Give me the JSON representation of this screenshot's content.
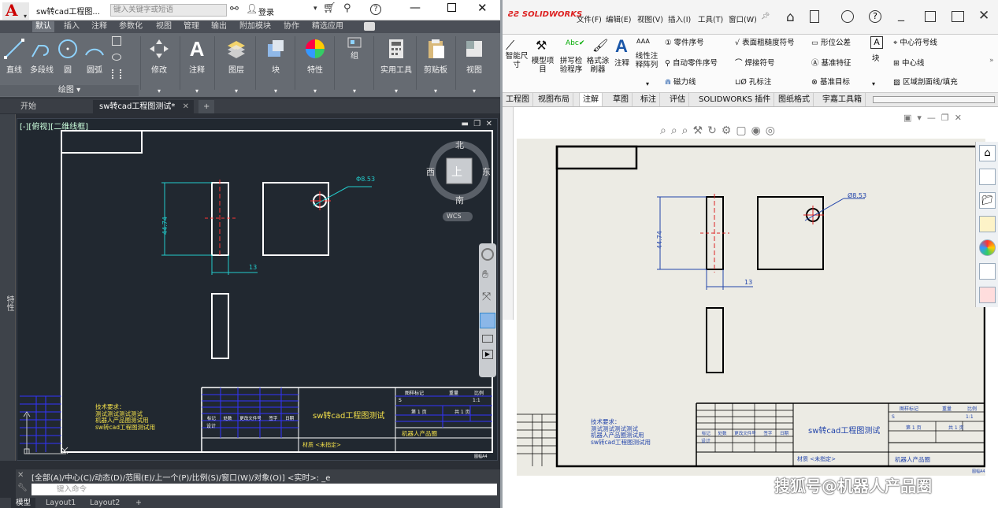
{
  "autocad": {
    "title": "sw转cad工程图...",
    "search_placeholder": "键入关键字或短语",
    "login": "登录",
    "ribbon_tabs": [
      "默认",
      "插入",
      "注释",
      "参数化",
      "视图",
      "管理",
      "输出",
      "附加模块",
      "协作",
      "精选应用"
    ],
    "draw_tools": [
      "直线",
      "多段线",
      "圆",
      "圆弧"
    ],
    "draw_panel_label": "绘图",
    "ribbon_buttons": [
      "修改",
      "注释",
      "图层",
      "块",
      "特性",
      "组",
      "实用工具",
      "剪贴板",
      "视图"
    ],
    "doc_tabs": [
      "开始",
      "sw转cad工程图测试*"
    ],
    "side_label": "特性",
    "viewport_label": "[-][俯视][二维线框]",
    "viewcube": {
      "north": "北",
      "south": "南",
      "east": "东",
      "west": "西",
      "top": "上",
      "wcs": "WCS"
    },
    "dims": {
      "hole": "Φ8.53",
      "height": "44.74",
      "width": "13"
    },
    "notes": [
      "技术要求：",
      "测试测试测试测试",
      "机器人产品圈测试用",
      "sw转cad工程图测试用"
    ],
    "title_block": {
      "title": "sw转cad工程图测试",
      "material": "材质 <未指定>",
      "company": "机器人产品圈",
      "scale": "1:1",
      "sheet": "第 1 页",
      "sheets": "共 1 页",
      "mark": "图样标记",
      "weight": "重量",
      "ratio": "比例",
      "s": "S",
      "rev_cols": [
        "标记",
        "处数",
        "更改文件号",
        "签字",
        "日期"
      ],
      "design": "设计",
      "a4": "图幅A4"
    },
    "command_history": "[全部(A)/中心(C)/动态(D)/范围(E)/上一个(P)/比例(S)/窗口(W)/对象(O)] <实时>: _e",
    "command_placeholder": "键入命令",
    "layout_tabs": [
      "模型",
      "Layout1",
      "Layout2"
    ]
  },
  "solidworks": {
    "logo": "SOLIDWORKS",
    "menu": [
      "文件(F)",
      "编辑(E)",
      "视图(V)",
      "插入(I)",
      "工具(T)",
      "窗口(W)"
    ],
    "ribbon": [
      "智能尺寸",
      "模型项目",
      "拼写检验程序",
      "格式涂刷器",
      "注释",
      "线性注释阵列",
      "零件序号",
      "自动零件序号",
      "磁力线",
      "表面粗糙度符号",
      "焊接符号",
      "孔标注",
      "形位公差",
      "基准特征",
      "基准目标",
      "块",
      "中心符号线",
      "中心线",
      "区域剖面线/填充"
    ],
    "tabs": [
      "工程图",
      "视图布局",
      "注解",
      "草图",
      "标注",
      "评估",
      "SOLIDWORKS 插件",
      "图纸格式",
      "宇嘉工具箱"
    ],
    "dims": {
      "hole": "Ø8.53",
      "height": "44.74",
      "width": "13"
    },
    "notes": [
      "技术要求：",
      "测试测试测试测试",
      "机器人产品圈测试用",
      "sw转cad工程图测试用"
    ],
    "title_block": {
      "title": "sw转cad工程图测试",
      "material": "材质 <未指定>",
      "company": "机器人产品圈",
      "scale": "1:1",
      "sheet": "第 1 页",
      "sheets": "共 1 页",
      "mark": "图样标记",
      "weight": "重量",
      "ratio": "比例",
      "s": "S",
      "rev_cols": [
        "标记",
        "处数",
        "更改文件号",
        "签字",
        "日期"
      ],
      "design": "设计",
      "a4": "图幅A4"
    }
  },
  "watermark": "搜狐号@机器人产品圈"
}
